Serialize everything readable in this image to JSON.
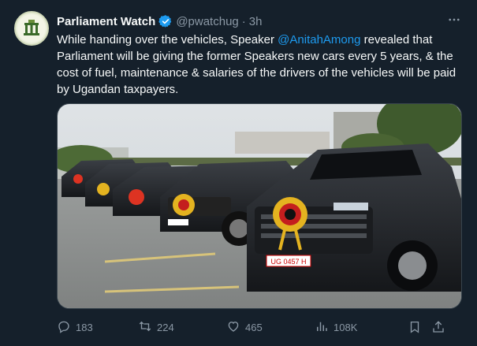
{
  "tweet": {
    "display_name": "Parliament Watch",
    "handle": "@pwatchug",
    "separator": "·",
    "time": "3h",
    "text_part1": "While handing over the vehicles, Speaker ",
    "mention": "@AnitahAmong",
    "text_part2": "  revealed that Parliament will be giving the former Speakers new cars every 5 years, & the cost of fuel, maintenance & salaries of the drivers of the vehicles will be paid by Ugandan taxpayers.",
    "media_alt": "Row of black SUVs with ribbon flowers on display",
    "plate_text": "UG 0457 H"
  },
  "actions": {
    "replies": "183",
    "reposts": "224",
    "likes": "465",
    "views": "108K"
  },
  "colors": {
    "background": "#15202b",
    "accent": "#1d9bf0",
    "muted": "#8b98a5"
  },
  "icons": [
    "avatar-logo",
    "verified-badge-icon",
    "more-icon",
    "reply-icon",
    "repost-icon",
    "like-icon",
    "views-icon",
    "bookmark-icon",
    "share-icon"
  ]
}
